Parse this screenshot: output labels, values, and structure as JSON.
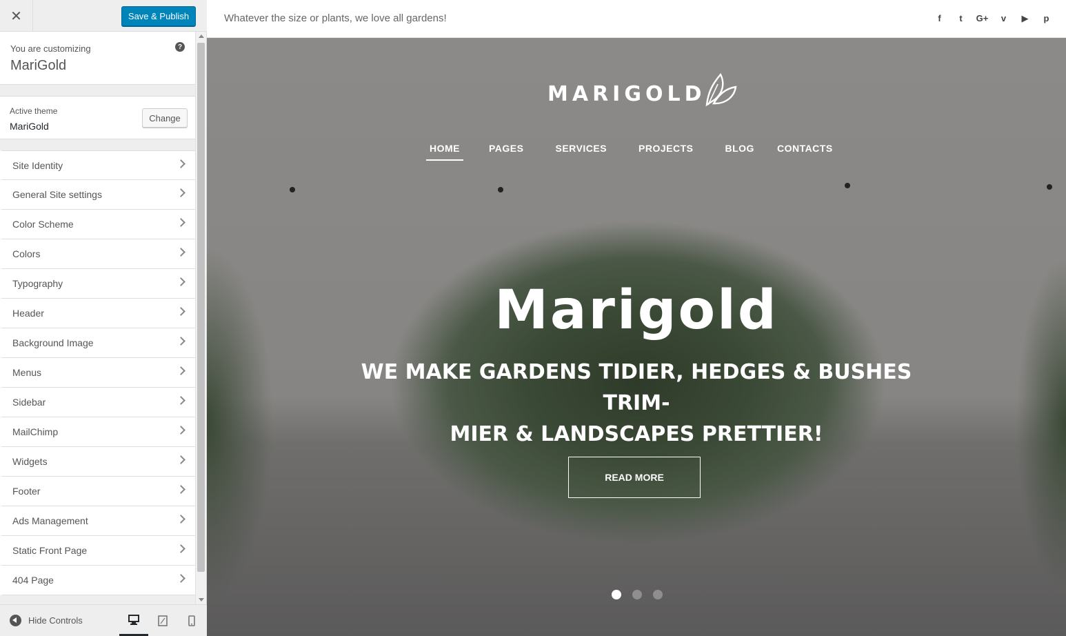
{
  "sidebar": {
    "close_label": "✕",
    "save_label": "Save & Publish",
    "customizing_label": "You are customizing",
    "site_name": "MariGold",
    "help_label": "?",
    "active_theme_label": "Active theme",
    "theme_name": "MariGold",
    "change_label": "Change",
    "sections": [
      {
        "label": "Site Identity"
      },
      {
        "label": "General Site settings"
      },
      {
        "label": "Color Scheme"
      },
      {
        "label": "Colors"
      },
      {
        "label": "Typography"
      },
      {
        "label": "Header"
      },
      {
        "label": "Background Image"
      },
      {
        "label": "Menus"
      },
      {
        "label": "Sidebar"
      },
      {
        "label": "MailChimp"
      },
      {
        "label": "Widgets"
      },
      {
        "label": "Footer"
      },
      {
        "label": "Ads Management"
      },
      {
        "label": "Static Front Page"
      },
      {
        "label": "404 Page"
      }
    ],
    "footer": {
      "hide_controls_label": "Hide Controls",
      "devices": [
        "desktop-icon",
        "tablet-icon",
        "mobile-icon"
      ]
    }
  },
  "preview": {
    "tagline": "Whatever the size or plants, we love all gardens!",
    "socials": [
      {
        "icon": "facebook-icon",
        "glyph": "f"
      },
      {
        "icon": "twitter-icon",
        "glyph": "t"
      },
      {
        "icon": "google-plus-icon",
        "glyph": "G+"
      },
      {
        "icon": "vimeo-icon",
        "glyph": "v"
      },
      {
        "icon": "youtube-icon",
        "glyph": "▶"
      },
      {
        "icon": "pinterest-icon",
        "glyph": "p"
      }
    ],
    "logo_text": "MARIGOLD",
    "nav": [
      "HOME",
      "PAGES",
      "SERVICES",
      "PROJECTS",
      "BLOG",
      "CONTACTS"
    ],
    "hero_title": "Marigold",
    "hero_subtitle_line1": "WE MAKE GARDENS TIDIER, HEDGES & BUSHES TRIM-",
    "hero_subtitle_line2": "MIER & LANDSCAPES PRETTIER!",
    "cta_label": "READ MORE",
    "slides": 3,
    "active_slide": 1
  },
  "colors": {
    "primary_button": "#0085ba",
    "sidebar_bg": "#eeeeee",
    "text": "#555555"
  }
}
